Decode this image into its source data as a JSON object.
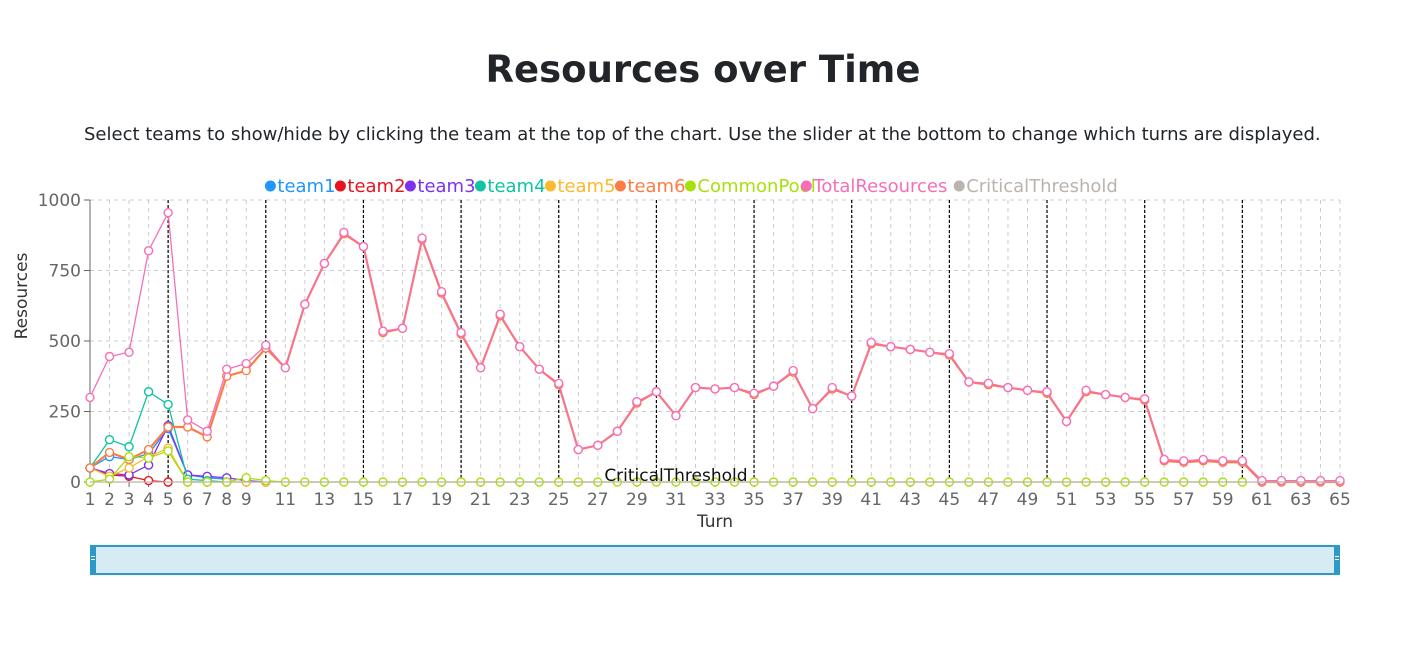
{
  "page": {
    "title": "Resources over Time",
    "description": "Select teams to show/hide by clicking the team at the top of the chart. Use the slider at the bottom to change which turns are displayed."
  },
  "colors": {
    "team1": "#1f97ff",
    "team2": "#e8141f",
    "team3": "#7d32ee",
    "team4": "#0fc3a3",
    "team5": "#fbb92d",
    "team6": "#fb7d45",
    "CommonPool": "#a8e00f",
    "TotalResources": "#f56fb8",
    "CriticalThreshold": "#bbb3ac",
    "grid": "#cccccc",
    "brush_fill": "#d7ebf5",
    "brush_stroke": "#2b9bc5"
  },
  "chart_data": {
    "type": "line",
    "xlabel": "Turn",
    "ylabel": "Resources",
    "xlim": [
      1,
      65
    ],
    "ylim": [
      0,
      1000
    ],
    "yticks": [
      0,
      250,
      500,
      750,
      1000
    ],
    "xticks": [
      1,
      2,
      3,
      4,
      5,
      6,
      7,
      8,
      9,
      11,
      13,
      15,
      17,
      19,
      21,
      23,
      25,
      27,
      29,
      31,
      33,
      35,
      37,
      39,
      41,
      43,
      45,
      47,
      49,
      51,
      53,
      55,
      57,
      59,
      61,
      63,
      65
    ],
    "x": [
      1,
      2,
      3,
      4,
      5,
      6,
      7,
      8,
      9,
      10,
      11,
      12,
      13,
      14,
      15,
      16,
      17,
      18,
      19,
      20,
      21,
      22,
      23,
      24,
      25,
      26,
      27,
      28,
      29,
      30,
      31,
      32,
      33,
      34,
      35,
      36,
      37,
      38,
      39,
      40,
      41,
      42,
      43,
      44,
      45,
      46,
      47,
      48,
      49,
      50,
      51,
      52,
      53,
      54,
      55,
      56,
      57,
      58,
      59,
      60,
      61,
      62,
      63,
      64,
      65
    ],
    "grid": true,
    "legend_position": "top-center",
    "season_markers": [
      5,
      10,
      15,
      20,
      25,
      30,
      35,
      40,
      45,
      50,
      55,
      60
    ],
    "annotations": [
      {
        "text": "CriticalThreshold",
        "x": 31,
        "y": 0
      }
    ],
    "series": [
      {
        "name": "team1",
        "values": [
          50,
          90,
          80,
          100,
          190,
          25,
          15,
          10,
          null,
          null,
          null,
          null,
          null,
          null,
          null,
          null,
          null,
          null,
          null,
          null,
          null,
          null,
          null,
          null,
          null,
          null,
          null,
          null,
          null,
          null,
          null,
          null,
          null,
          null,
          null,
          null,
          null,
          null,
          null,
          null,
          null,
          null,
          null,
          null,
          null,
          null,
          null,
          null,
          null,
          null,
          null,
          null,
          null,
          null,
          null,
          null,
          null,
          null,
          null,
          null,
          null,
          null,
          null,
          null,
          null
        ]
      },
      {
        "name": "team2",
        "values": [
          50,
          25,
          20,
          5,
          0,
          null,
          null,
          null,
          null,
          null,
          null,
          null,
          null,
          null,
          null,
          null,
          null,
          null,
          null,
          null,
          null,
          null,
          null,
          null,
          null,
          null,
          null,
          null,
          null,
          null,
          null,
          null,
          null,
          null,
          null,
          null,
          null,
          null,
          null,
          null,
          null,
          null,
          null,
          null,
          null,
          null,
          null,
          null,
          null,
          null,
          null,
          null,
          null,
          null,
          null,
          null,
          null,
          null,
          null,
          null,
          null,
          null,
          null,
          null,
          null
        ]
      },
      {
        "name": "team3",
        "values": [
          50,
          30,
          25,
          60,
          200,
          25,
          20,
          15,
          5,
          0,
          null,
          null,
          null,
          null,
          null,
          null,
          null,
          null,
          null,
          null,
          null,
          null,
          null,
          null,
          null,
          null,
          null,
          null,
          null,
          null,
          null,
          null,
          null,
          null,
          null,
          null,
          null,
          null,
          null,
          null,
          null,
          null,
          null,
          null,
          null,
          null,
          null,
          null,
          null,
          null,
          null,
          null,
          null,
          null,
          null,
          null,
          null,
          null,
          null,
          null,
          null,
          null,
          null,
          null,
          null
        ]
      },
      {
        "name": "team4",
        "values": [
          50,
          150,
          125,
          320,
          275,
          10,
          5,
          0,
          null,
          null,
          null,
          null,
          null,
          null,
          null,
          null,
          null,
          null,
          null,
          null,
          null,
          null,
          null,
          null,
          null,
          null,
          null,
          null,
          null,
          null,
          null,
          null,
          null,
          null,
          null,
          null,
          null,
          null,
          null,
          null,
          null,
          null,
          null,
          null,
          null,
          null,
          null,
          null,
          null,
          null,
          null,
          null,
          null,
          null,
          null,
          null,
          null,
          null,
          null,
          null,
          null,
          null,
          null,
          null,
          null
        ]
      },
      {
        "name": "team5",
        "values": [
          50,
          20,
          50,
          90,
          120,
          0,
          0,
          0,
          0,
          0,
          null,
          null,
          null,
          null,
          null,
          null,
          null,
          null,
          null,
          null,
          null,
          null,
          null,
          null,
          null,
          null,
          null,
          null,
          null,
          null,
          null,
          null,
          null,
          null,
          null,
          null,
          null,
          null,
          null,
          null,
          null,
          null,
          null,
          null,
          null,
          null,
          null,
          null,
          null,
          null,
          null,
          null,
          null,
          null,
          null,
          null,
          null,
          null,
          null,
          null,
          null,
          null,
          null,
          null,
          null
        ]
      },
      {
        "name": "team6",
        "values": [
          50,
          105,
          80,
          115,
          195,
          195,
          160,
          375,
          395,
          475,
          405,
          630,
          775,
          880,
          835,
          530,
          545,
          860,
          670,
          525,
          405,
          590,
          480,
          400,
          345,
          115,
          130,
          180,
          280,
          320,
          235,
          335,
          330,
          335,
          310,
          340,
          390,
          260,
          330,
          305,
          490,
          480,
          470,
          460,
          450,
          355,
          345,
          335,
          325,
          315,
          215,
          320,
          310,
          300,
          290,
          75,
          70,
          75,
          70,
          70,
          0,
          0,
          0,
          0,
          0
        ]
      },
      {
        "name": "CommonPool",
        "values": [
          0,
          10,
          90,
          85,
          110,
          0,
          0,
          0,
          15,
          5,
          0,
          0,
          0,
          0,
          0,
          0,
          0,
          0,
          0,
          0,
          0,
          0,
          0,
          0,
          0,
          0,
          0,
          0,
          0,
          0,
          0,
          0,
          0,
          0,
          0,
          0,
          0,
          0,
          0,
          0,
          0,
          0,
          0,
          0,
          0,
          0,
          0,
          0,
          0,
          0,
          0,
          0,
          0,
          0,
          0,
          0,
          0,
          0,
          0,
          0,
          null,
          null,
          null,
          null,
          null
        ]
      },
      {
        "name": "TotalResources",
        "values": [
          300,
          445,
          460,
          820,
          955,
          220,
          180,
          400,
          420,
          485,
          405,
          630,
          775,
          885,
          835,
          535,
          545,
          865,
          675,
          530,
          405,
          595,
          480,
          400,
          350,
          115,
          130,
          180,
          285,
          320,
          235,
          335,
          330,
          335,
          315,
          340,
          395,
          260,
          335,
          305,
          495,
          480,
          470,
          460,
          455,
          355,
          350,
          335,
          325,
          320,
          215,
          325,
          310,
          300,
          295,
          80,
          75,
          80,
          75,
          75,
          5,
          5,
          5,
          5,
          5
        ]
      },
      {
        "name": "CriticalThreshold",
        "values": [
          0,
          0,
          0,
          0,
          0,
          0,
          0,
          0,
          0,
          0,
          0,
          0,
          0,
          0,
          0,
          0,
          0,
          0,
          0,
          0,
          0,
          0,
          0,
          0,
          0,
          0,
          0,
          0,
          0,
          0,
          0,
          0,
          0,
          0,
          0,
          0,
          0,
          0,
          0,
          0,
          0,
          0,
          0,
          0,
          0,
          0,
          0,
          0,
          0,
          0,
          0,
          0,
          0,
          0,
          0,
          0,
          0,
          0,
          0,
          0,
          0,
          0,
          0,
          0,
          0
        ]
      }
    ]
  }
}
